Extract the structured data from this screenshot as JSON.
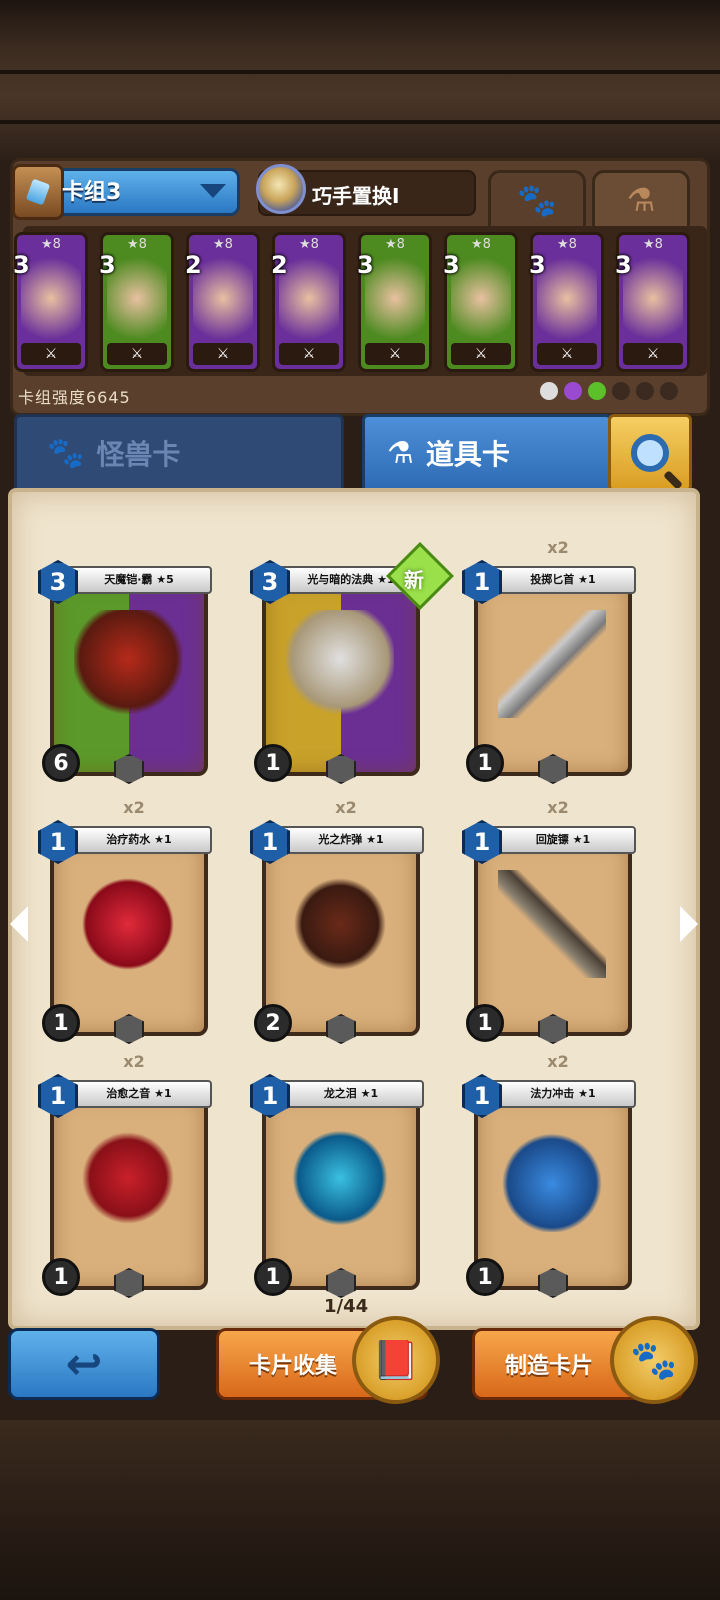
{
  "header": {
    "deck_name": "卡组3",
    "pet_name": "巧手置换Ⅰ",
    "tab_icons": [
      "paw-icon",
      "potion-icon"
    ],
    "deck_strength_label": "卡组强度6645"
  },
  "deck_cards": [
    {
      "stars": "★8",
      "cost": "3",
      "color": "#6a2f9a"
    },
    {
      "stars": "★8",
      "cost": "3",
      "color": "#4d8a20"
    },
    {
      "stars": "★8",
      "cost": "2",
      "color": "#6a2f9a"
    },
    {
      "stars": "★8",
      "cost": "2",
      "color": "#6a2f9a"
    },
    {
      "stars": "★8",
      "cost": "3",
      "color": "#4d8a20"
    },
    {
      "stars": "★8",
      "cost": "3",
      "color": "#4d8a20"
    },
    {
      "stars": "★8",
      "cost": "3",
      "color": "#6a2f9a"
    },
    {
      "stars": "★8",
      "cost": "3",
      "color": "#6a2f9a"
    }
  ],
  "category_tabs": {
    "monster_label": "怪兽卡",
    "item_label": "道具卡"
  },
  "cards": [
    {
      "name": "天魔铠·霸 ★5",
      "cost": "3",
      "copies": "",
      "bottom": "6",
      "type": "monster",
      "badge": ""
    },
    {
      "name": "光与暗的法典 ★1",
      "cost": "3",
      "copies": "",
      "bottom": "1",
      "type": "special",
      "badge": "新"
    },
    {
      "name": "投掷匕首 ★1",
      "cost": "1",
      "copies": "x2",
      "bottom": "1",
      "type": "item",
      "badge": ""
    },
    {
      "name": "治疗药水 ★1",
      "cost": "1",
      "copies": "x2",
      "bottom": "1",
      "type": "item",
      "badge": ""
    },
    {
      "name": "光之炸弹 ★1",
      "cost": "1",
      "copies": "x2",
      "bottom": "2",
      "type": "item",
      "badge": ""
    },
    {
      "name": "回旋镖 ★1",
      "cost": "1",
      "copies": "x2",
      "bottom": "1",
      "type": "item",
      "badge": ""
    },
    {
      "name": "治愈之音 ★1",
      "cost": "1",
      "copies": "x2",
      "bottom": "1",
      "type": "item",
      "badge": ""
    },
    {
      "name": "龙之泪 ★1",
      "cost": "1",
      "copies": "",
      "bottom": "1",
      "type": "item",
      "badge": ""
    },
    {
      "name": "法力冲击 ★1",
      "cost": "1",
      "copies": "x2",
      "bottom": "1",
      "type": "item",
      "badge": ""
    }
  ],
  "pagination": {
    "text": "1/44"
  },
  "buttons": {
    "collect_label": "卡片收集",
    "craft_label": "制造卡片"
  }
}
